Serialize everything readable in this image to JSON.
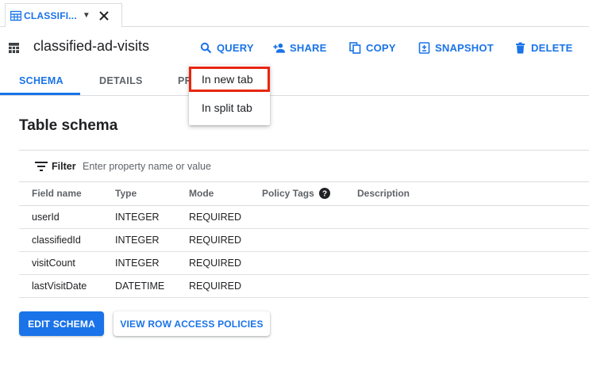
{
  "tab": {
    "label": "CLASSIFI...",
    "icon": "table-icon"
  },
  "header": {
    "title": "classified-ad-visits",
    "actions": [
      {
        "label": "QUERY",
        "icon": "search-icon"
      },
      {
        "label": "SHARE",
        "icon": "person-add-icon"
      },
      {
        "label": "COPY",
        "icon": "copy-icon"
      },
      {
        "label": "SNAPSHOT",
        "icon": "snapshot-icon"
      },
      {
        "label": "DELETE",
        "icon": "trash-icon"
      }
    ]
  },
  "subtabs": [
    {
      "label": "SCHEMA",
      "active": true
    },
    {
      "label": "DETAILS",
      "active": false
    },
    {
      "label": "PR",
      "active": false
    }
  ],
  "menu": {
    "items": [
      "In new tab",
      "In split tab"
    ]
  },
  "schema": {
    "title": "Table schema",
    "filter": {
      "label": "Filter",
      "placeholder": "Enter property name or value"
    },
    "columns": [
      "Field name",
      "Type",
      "Mode",
      "Policy Tags",
      "Description"
    ],
    "rows": [
      {
        "field": "userId",
        "type": "INTEGER",
        "mode": "REQUIRED"
      },
      {
        "field": "classifiedId",
        "type": "INTEGER",
        "mode": "REQUIRED"
      },
      {
        "field": "visitCount",
        "type": "INTEGER",
        "mode": "REQUIRED"
      },
      {
        "field": "lastVisitDate",
        "type": "DATETIME",
        "mode": "REQUIRED"
      }
    ]
  },
  "buttons": {
    "edit_schema": "EDIT SCHEMA",
    "row_access": "VIEW ROW ACCESS POLICIES"
  },
  "colors": {
    "accent": "#1a73e8",
    "highlight": "#e8260f",
    "text": "#202124",
    "muted": "#5f6368"
  }
}
